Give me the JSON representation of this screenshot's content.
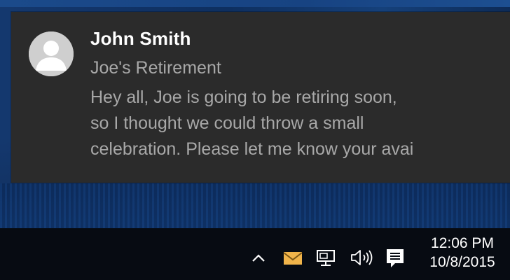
{
  "notification": {
    "sender": "John Smith",
    "subject": "Joe's Retirement",
    "body_lines": [
      "Hey all, Joe is going to be retiring soon,",
      "so I thought we could throw a small",
      "celebration. Please let me know your avai"
    ],
    "avatar_icon": "person-icon"
  },
  "taskbar": {
    "tray_icons": [
      "chevron-up-icon",
      "mail-icon",
      "network-icon",
      "volume-icon",
      "action-center-icon"
    ],
    "time": "12:06 PM",
    "date": "10/8/2015",
    "colors": {
      "taskbar_bg": "#070b12",
      "mail_accent": "#f0b44a",
      "toast_bg": "#2b2b2b"
    }
  }
}
